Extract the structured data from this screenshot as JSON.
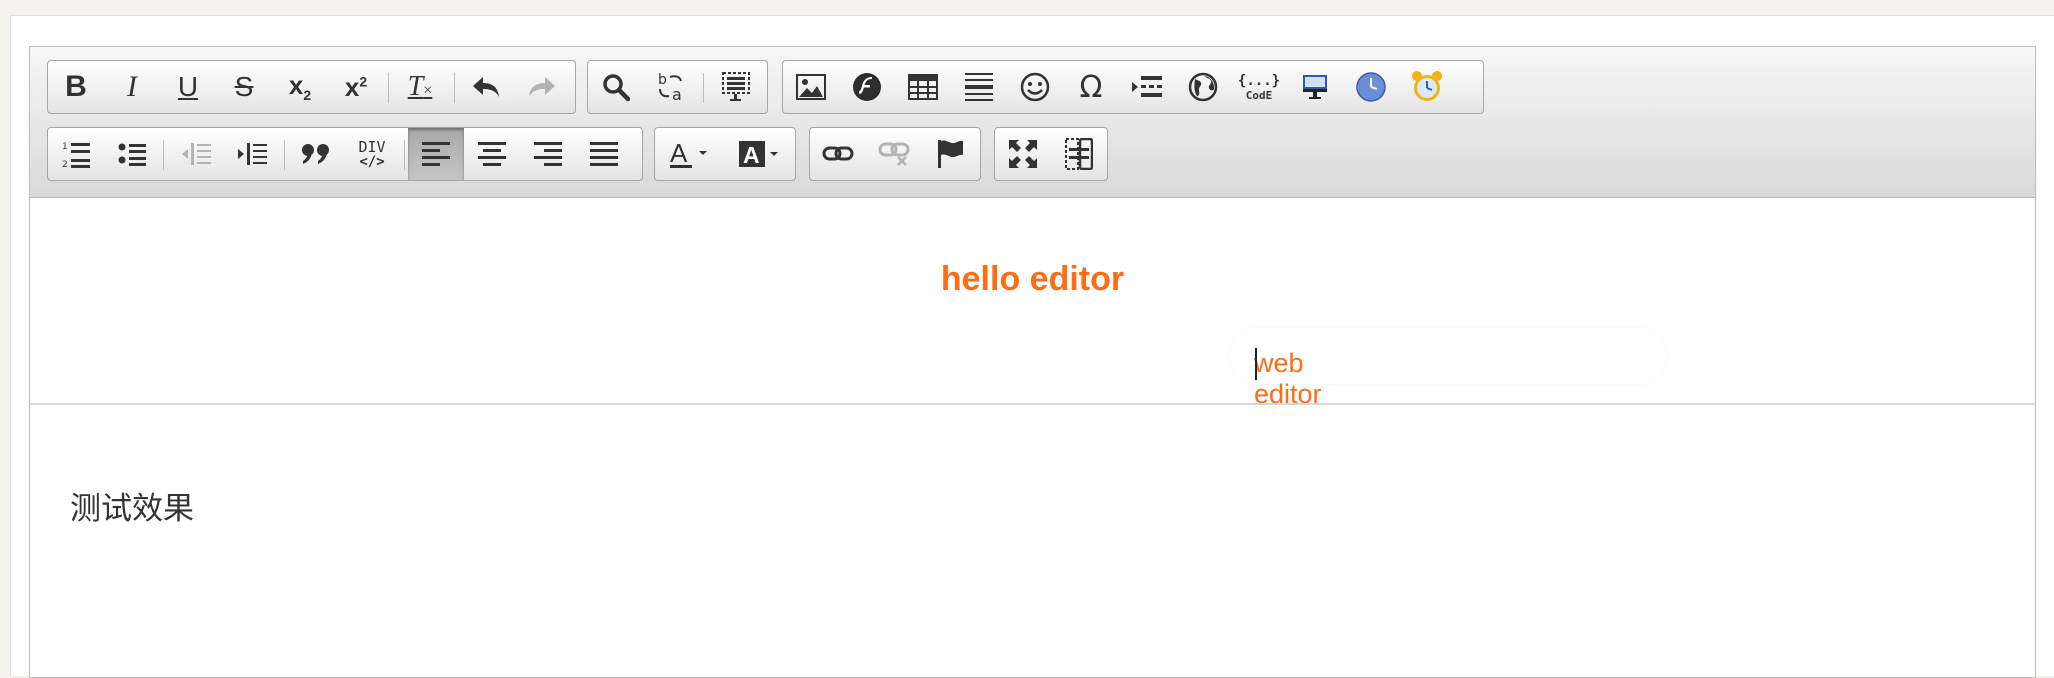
{
  "toolbar": {
    "row1": {
      "group1": [
        "bold-icon",
        "italic-icon",
        "underline-icon",
        "strikethrough-icon",
        "subscript-icon",
        "superscript-icon",
        "remove-format-icon",
        "undo-icon",
        "redo-icon"
      ],
      "group2": [
        "find-icon",
        "replace-icon",
        "select-all-icon"
      ],
      "group3": [
        "image-icon",
        "flash-icon",
        "table-icon",
        "horizontal-line-icon",
        "smiley-icon",
        "special-char-icon",
        "page-break-icon",
        "iframe-icon",
        "code-snippet-icon",
        "template-icon",
        "clock-icon",
        "alarm-clock-icon"
      ]
    },
    "row2": {
      "group1": [
        "numbered-list-icon",
        "bulleted-list-icon",
        "outdent-icon",
        "indent-icon",
        "blockquote-icon",
        "div-container-icon",
        "align-left-icon",
        "align-center-icon",
        "align-right-icon",
        "justify-icon"
      ],
      "group2": [
        "text-color-icon",
        "background-color-icon"
      ],
      "group3": [
        "link-icon",
        "unlink-icon",
        "anchor-icon"
      ],
      "group4": [
        "maximize-icon",
        "show-blocks-icon"
      ]
    },
    "labels": {
      "sub": "2",
      "sup": "2",
      "div": "DIV",
      "code_top": "{...}",
      "code_bottom": "CodE"
    }
  },
  "content": {
    "heading": "hello editor",
    "subtext": "web editor",
    "body_text": "测试效果"
  },
  "colors": {
    "accent": "#ff6c16",
    "flash": "#2d2d2d",
    "clock": "#6b8fd6"
  }
}
